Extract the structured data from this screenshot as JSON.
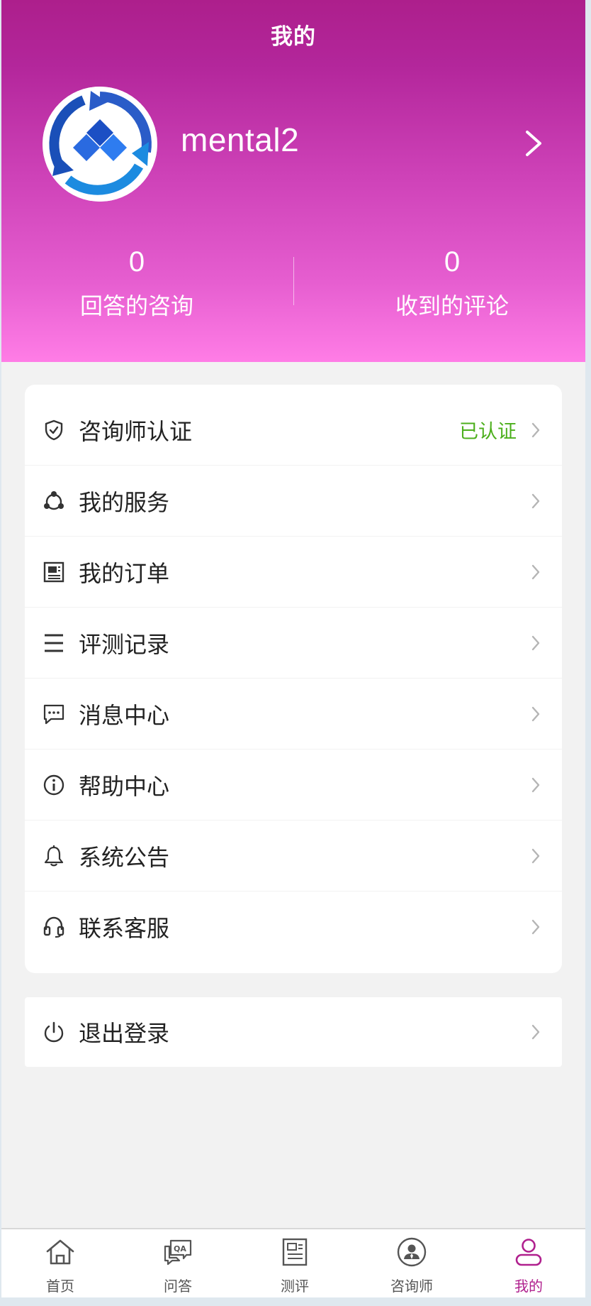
{
  "header": {
    "title": "我的",
    "username": "mental2",
    "stats": [
      {
        "value": "0",
        "label": "回答的咨询"
      },
      {
        "value": "0",
        "label": "收到的评论"
      }
    ]
  },
  "menu": {
    "items": [
      {
        "label": "咨询师认证",
        "status": "已认证",
        "icon": "shield-check-icon"
      },
      {
        "label": "我的服务",
        "icon": "share-circle-icon"
      },
      {
        "label": "我的订单",
        "icon": "newspaper-icon"
      },
      {
        "label": "评测记录",
        "icon": "list-icon"
      },
      {
        "label": "消息中心",
        "icon": "chat-bubble-icon"
      },
      {
        "label": "帮助中心",
        "icon": "info-circle-icon"
      },
      {
        "label": "系统公告",
        "icon": "bell-icon"
      },
      {
        "label": "联系客服",
        "icon": "headset-icon"
      }
    ]
  },
  "logout": {
    "label": "退出登录",
    "icon": "power-icon"
  },
  "tabbar": {
    "items": [
      {
        "label": "首页",
        "icon": "home-icon"
      },
      {
        "label": "问答",
        "icon": "qa-chat-icon"
      },
      {
        "label": "测评",
        "icon": "document-icon"
      },
      {
        "label": "咨询师",
        "icon": "counselor-icon"
      },
      {
        "label": "我的",
        "icon": "user-icon",
        "active": true
      }
    ]
  },
  "colors": {
    "brand": "#b0208e",
    "header_top": "#ad1f8c",
    "header_bottom": "#ff7de6",
    "verified": "#4caf1c"
  }
}
